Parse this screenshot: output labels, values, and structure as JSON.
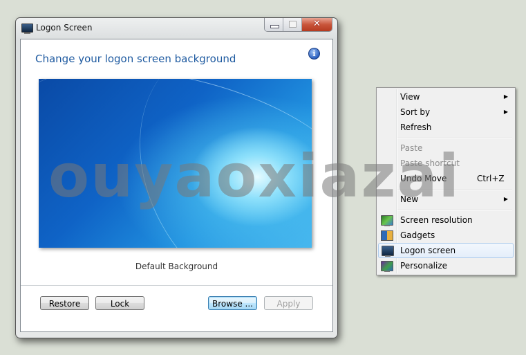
{
  "window": {
    "title": "Logon Screen",
    "controls": {
      "minimize": "minimize",
      "maximize": "maximize",
      "close": "✕"
    },
    "heading": "Change your logon screen background",
    "info_icon": "i",
    "preview_caption": "Default Background",
    "buttons": {
      "restore": "Restore",
      "lock": "Lock",
      "browse": "Browse ...",
      "apply": "Apply"
    },
    "apply_enabled": false
  },
  "context_menu": {
    "items": [
      {
        "label": "View",
        "submenu": true,
        "arrow": "▶",
        "disabled": false
      },
      {
        "label": "Sort by",
        "submenu": true,
        "arrow": "▶",
        "disabled": false
      },
      {
        "label": "Refresh",
        "disabled": false
      },
      {
        "label": "Paste",
        "disabled": true
      },
      {
        "label": "Paste shortcut",
        "disabled": true
      },
      {
        "label": "Undo Move",
        "shortcut": "Ctrl+Z",
        "disabled": false
      },
      {
        "label": "New",
        "submenu": true,
        "arrow": "▶",
        "disabled": false
      },
      {
        "label": "Screen resolution",
        "icon": "screen-resolution-icon",
        "disabled": false
      },
      {
        "label": "Gadgets",
        "icon": "gadgets-icon",
        "disabled": false
      },
      {
        "label": "Logon screen",
        "icon": "logon-screen-icon",
        "highlighted": true,
        "disabled": false
      },
      {
        "label": "Personalize",
        "icon": "personalize-icon",
        "disabled": false
      }
    ]
  },
  "watermark": "ouyaoxiazai"
}
